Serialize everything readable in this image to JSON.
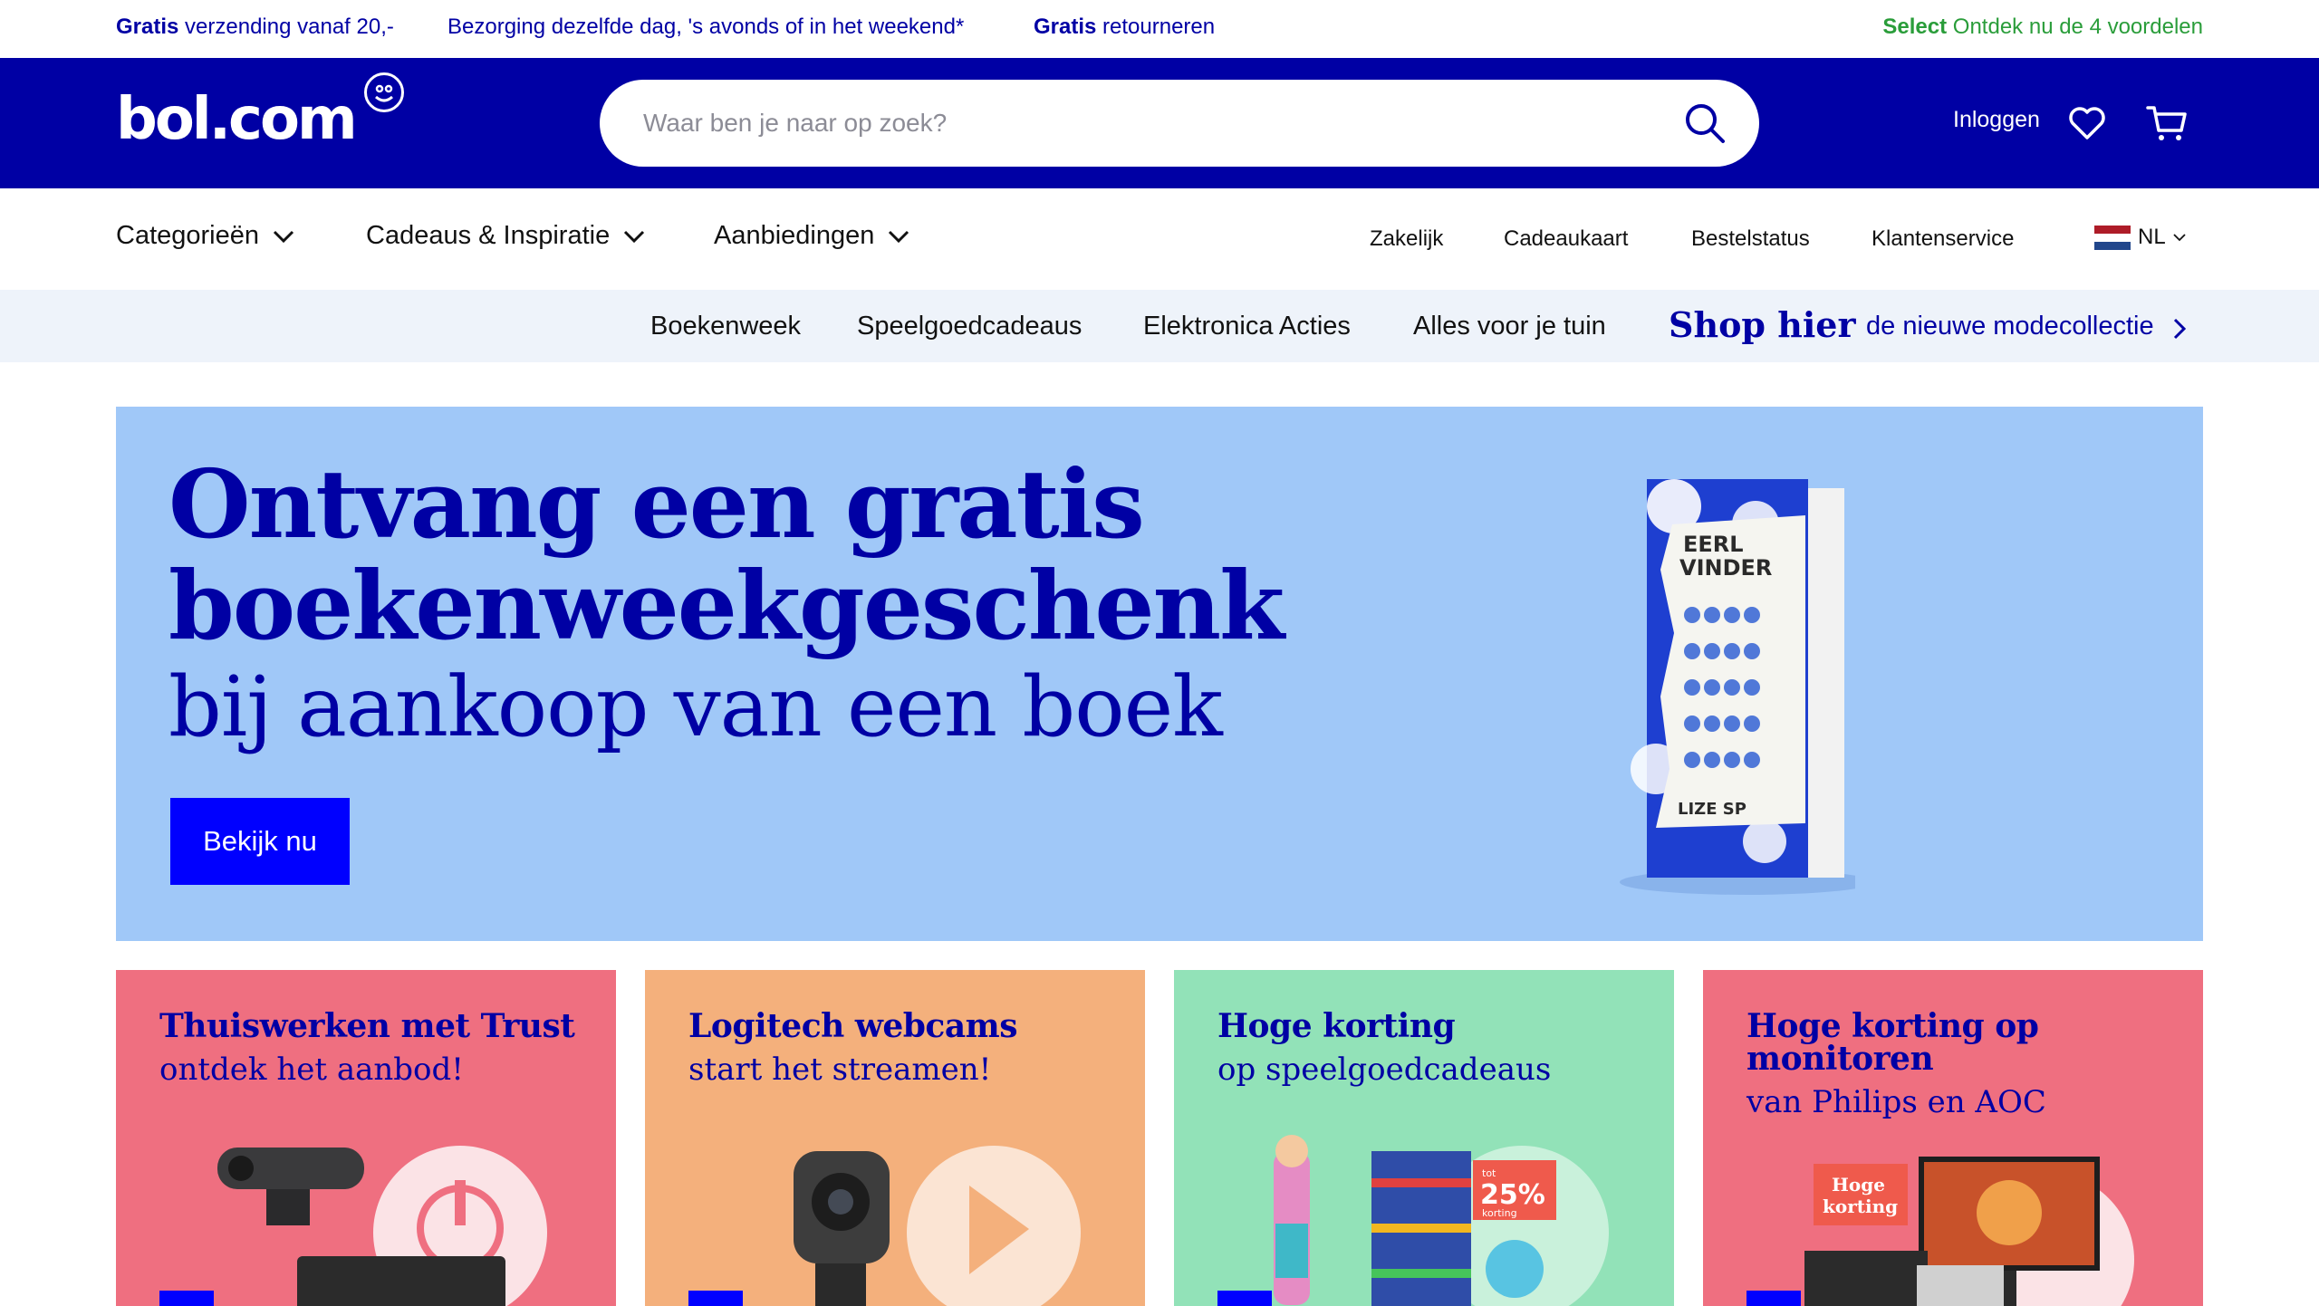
{
  "usp": {
    "shipping_bold": "Gratis",
    "shipping_rest": " verzending vanaf 20,-",
    "delivery": "Bezorging dezelfde dag, 's avonds of in het weekend*",
    "returns_bold": "Gratis",
    "returns_rest": " retourneren",
    "select_bold": "Select",
    "select_rest": " Ontdek nu de 4 voordelen"
  },
  "header": {
    "logo": "bol.com",
    "search_placeholder": "Waar ben je naar op zoek?",
    "login": "Inloggen"
  },
  "nav": {
    "main": [
      "Categorieën",
      "Cadeaus & Inspiratie",
      "Aanbiedingen"
    ],
    "secondary": [
      "Zakelijk",
      "Cadeaukaart",
      "Bestelstatus",
      "Klantenservice"
    ],
    "language": "NL"
  },
  "promo": {
    "links": [
      "Boekenweek",
      "Speelgoedcadeaus",
      "Elektronica Acties",
      "Alles voor je tuin"
    ],
    "shop_hier": "Shop hier",
    "shop_sub": "de nieuwe modecollectie"
  },
  "hero": {
    "title_line1": "Ontvang een gratis",
    "title_line2": "boekenweekgeschenk",
    "subtitle": "bij aankoop van een boek",
    "button": "Bekijk nu",
    "book_text1": "EERL",
    "book_text2": "VINDER",
    "book_text3": "LIZE SP"
  },
  "cards": [
    {
      "title": "Thuiswerken met Trust",
      "subtitle": "ontdek het aanbod!",
      "bg": "#ef6f80"
    },
    {
      "title": "Logitech webcams",
      "subtitle": "start het streamen!",
      "bg": "#f4b07c"
    },
    {
      "title": "Hoge korting",
      "subtitle": "op speelgoedcadeaus",
      "bg": "#92e2b8",
      "badge_small": "tot",
      "badge_big": "25%",
      "badge_small2": "korting"
    },
    {
      "title": "Hoge korting op monitoren",
      "subtitle": "van Philips en AOC",
      "bg": "#ef6f80",
      "badge1": "Hoge",
      "badge2": "korting"
    }
  ],
  "colors": {
    "brand_blue": "#0000a4",
    "button_blue": "#0000ff",
    "select_green": "#2a9d3a",
    "hero_bg": "#a0c8f8",
    "promo_strip_bg": "#eef3fa"
  }
}
